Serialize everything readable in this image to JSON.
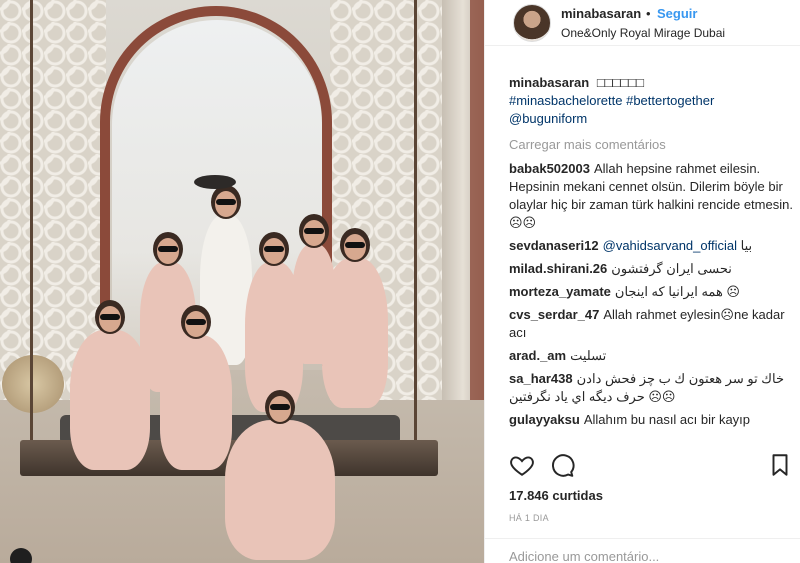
{
  "post": {
    "username": "minabasaran",
    "separator": "•",
    "follow_label": "Seguir",
    "location": "One&Only Royal Mirage Dubai"
  },
  "caption": {
    "username": "minabasaran",
    "text": "□□□□□□",
    "tags": [
      "#minasbachelorette",
      "#bettertogether",
      "@buguniform"
    ]
  },
  "load_more": "Carregar mais comentários",
  "comments": [
    {
      "user": "babak502003",
      "text": "Allah hepsine rahmet eilesin. Hepsinin mekani cennet olsün. Dilerim böyle bir olaylar hiç bir zaman türk halkini rencide etmesin. ☹☹",
      "mention": ""
    },
    {
      "user": "sevdanaseri12",
      "mention": "@vahidsarvand_official",
      "text": "بیا"
    },
    {
      "user": "milad.shirani.26",
      "mention": "",
      "text": "نحسی ایران گرفتشون"
    },
    {
      "user": "morteza_yamate",
      "mention": "",
      "text": "همه ایرانیا که اینجان ☹"
    },
    {
      "user": "cvs_serdar_47",
      "mention": "",
      "text": "Allah rahmet eylesin☹ne kadar acı"
    },
    {
      "user": "arad._am",
      "mention": "",
      "text": "تسلیت"
    },
    {
      "user": "sa_har438",
      "mention": "",
      "text": "خاك تو سر هعتون ك ب چز فحش دادن ☹☹ حرف ديگه اي ياد نگرفتين"
    },
    {
      "user": "gulayyaksu",
      "mention": "",
      "text": "Allahım bu nasıl acı bir kayıp"
    }
  ],
  "likes": "17.846 curtidas",
  "time": "HÁ 1 DIA",
  "add_comment_placeholder": "Adicione um comentário..."
}
